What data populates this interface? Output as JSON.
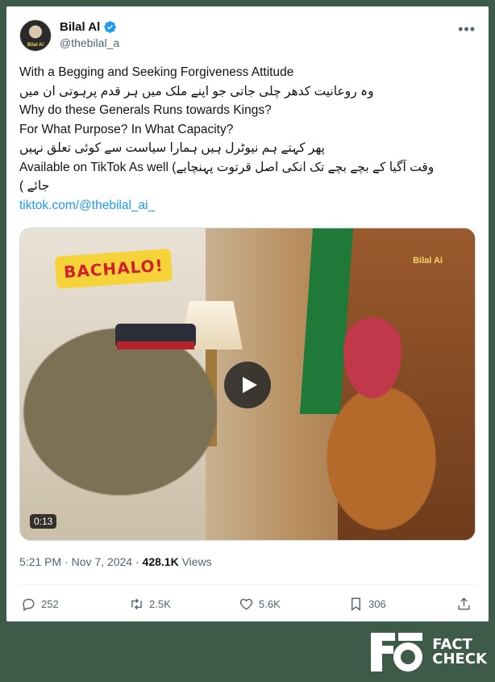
{
  "author": {
    "name": "Bilal Al",
    "handle": "@thebilal_a",
    "verified": true,
    "avatar_text": "Bilal Al"
  },
  "icons": {
    "more": "more-icon",
    "verified": "verified-badge-icon",
    "play": "play-icon",
    "reply": "reply-icon",
    "retweet": "retweet-icon",
    "like": "like-icon",
    "bookmark": "bookmark-icon",
    "share": "share-icon"
  },
  "tweet": {
    "line1": "With a Begging and Seeking Forgiveness Attitude",
    "line2": "وہ روعانیت کدھر چلی جاتی جو اپنے ملک میں ہر قدم پرہوتی ان میں",
    "line3": "Why do these Generals Runs towards Kings?",
    "line4": "For What Purpose? In What Capacity?",
    "line5": "پھر کہتے ہم نیوٹرل ہیں ہمارا سیاست سے کوئی تعلق نہیں",
    "line6": "Available on TikTok As well (وقت آگیا کے بچے بچے تک انکی اصل قرتوت پہنچایے",
    "line7": "جائے )",
    "link": "tiktok.com/@thebilal_ai_"
  },
  "media": {
    "overlay_text": "BACHALO!",
    "watermark": "Bilal Ai",
    "duration": "0:13"
  },
  "meta": {
    "time": "5:21 PM",
    "separator": "·",
    "date": "Nov 7, 2024",
    "views_count": "428.1K",
    "views_label": "Views"
  },
  "actions": {
    "replies": "252",
    "retweets": "2.5K",
    "likes": "5.6K",
    "bookmarks": "306"
  },
  "factcheck": {
    "line1": "FACT",
    "line2": "CHECK"
  },
  "colors": {
    "background": "#3e5a48",
    "link": "#1d9bf0",
    "text": "#0f1419",
    "muted": "#536471",
    "verified": "#1d9bf0"
  }
}
